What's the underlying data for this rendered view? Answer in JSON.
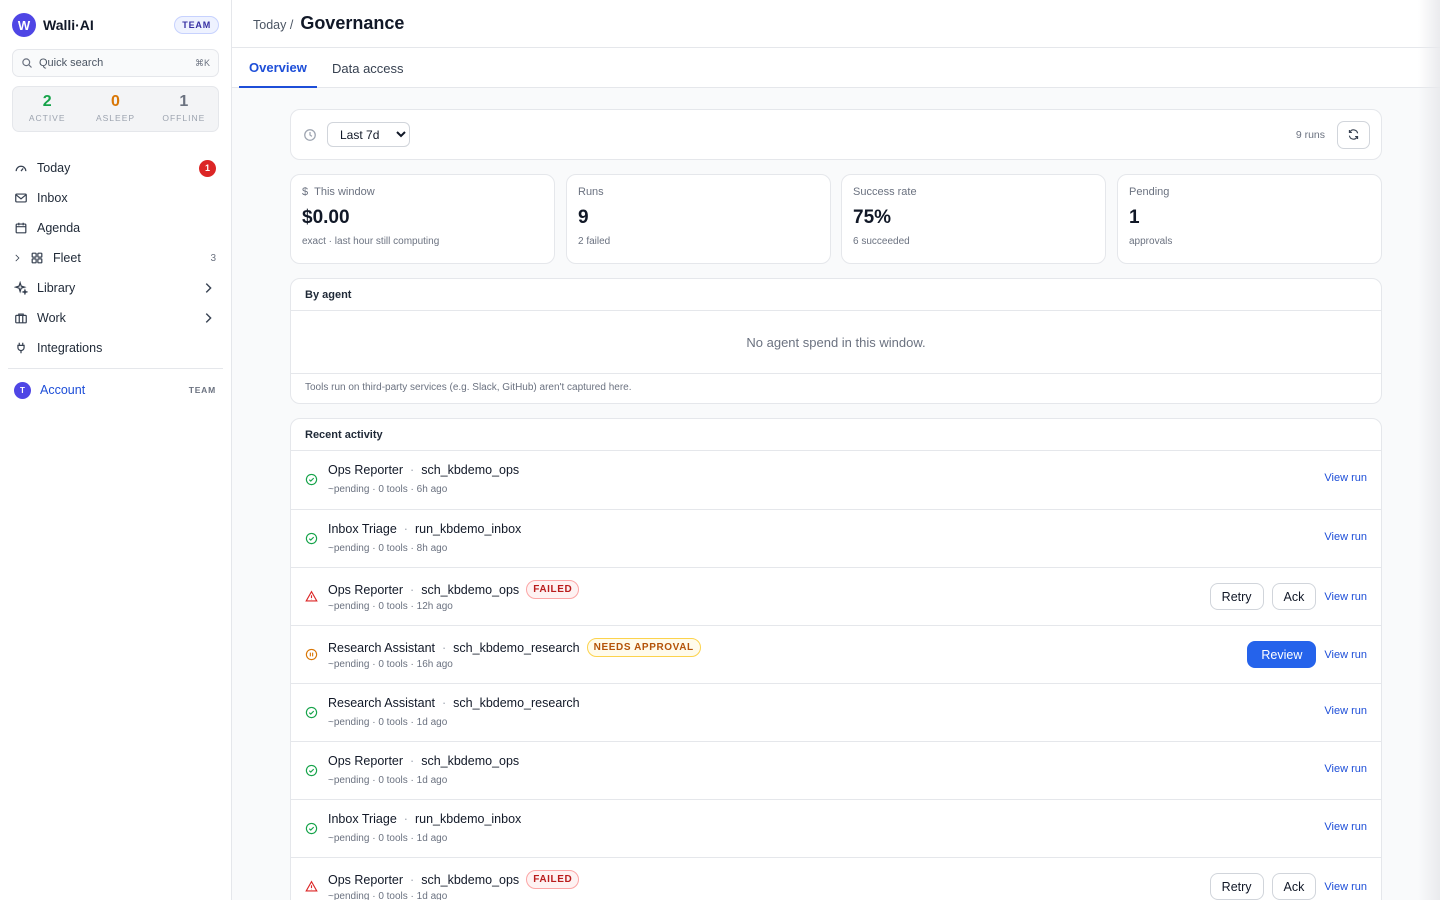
{
  "brand": {
    "logo_letter": "W",
    "name": "Walli·AI",
    "plan": "TEAM"
  },
  "search": {
    "placeholder": "Quick search",
    "shortcut": "⌘K"
  },
  "fleet_stats": [
    {
      "value": "2",
      "label": "ACTIVE",
      "color": "#16a34a"
    },
    {
      "value": "0",
      "label": "ASLEEP",
      "color": "#d97706"
    },
    {
      "value": "1",
      "label": "OFFLINE",
      "color": "#6b7280"
    }
  ],
  "nav": {
    "today": {
      "label": "Today",
      "badge": "1"
    },
    "inbox": {
      "label": "Inbox"
    },
    "agenda": {
      "label": "Agenda"
    },
    "fleet": {
      "label": "Fleet",
      "count": "3"
    },
    "library": {
      "label": "Library"
    },
    "work": {
      "label": "Work"
    },
    "integrations": {
      "label": "Integrations"
    }
  },
  "account": {
    "avatar": "T",
    "label": "Account",
    "plan": "TEAM"
  },
  "header": {
    "breadcrumb": "Today /",
    "title": "Governance"
  },
  "tabs": [
    {
      "label": "Overview",
      "active": true
    },
    {
      "label": "Data access",
      "active": false
    }
  ],
  "filter": {
    "range": "Last 7d",
    "options": [
      "Last 7d"
    ],
    "runs_count": "9 runs"
  },
  "kpis": [
    {
      "label": "This window",
      "value": "$0.00",
      "sub": "exact · last hour still computing"
    },
    {
      "label": "Runs",
      "value": "9",
      "sub": "2 failed"
    },
    {
      "label": "Success rate",
      "value": "75%",
      "sub": "6 succeeded"
    },
    {
      "label": "Pending",
      "value": "1",
      "sub": "approvals"
    }
  ],
  "by_agent": {
    "title": "By agent",
    "empty": "No agent spend in this window.",
    "footnote": "Tools run on third-party services (e.g. Slack, GitHub) aren't captured here."
  },
  "activity": {
    "title": "Recent activity",
    "view_run_label": "View run",
    "retry_label": "Retry",
    "ack_label": "Ack",
    "review_label": "Review",
    "rows": [
      {
        "status": "success",
        "agent": "Ops Reporter",
        "run_id": "sch_kbdemo_ops",
        "badge": "",
        "meta": "~pending · 0 tools · 6h ago"
      },
      {
        "status": "success",
        "agent": "Inbox Triage",
        "run_id": "run_kbdemo_inbox",
        "badge": "",
        "meta": "~pending · 0 tools · 8h ago"
      },
      {
        "status": "failed",
        "agent": "Ops Reporter",
        "run_id": "sch_kbdemo_ops",
        "badge": "FAILED",
        "meta": "~pending · 0 tools · 12h ago"
      },
      {
        "status": "approval",
        "agent": "Research Assistant",
        "run_id": "sch_kbdemo_research",
        "badge": "NEEDS APPROVAL",
        "meta": "~pending · 0 tools · 16h ago"
      },
      {
        "status": "success",
        "agent": "Research Assistant",
        "run_id": "sch_kbdemo_research",
        "badge": "",
        "meta": "~pending · 0 tools · 1d ago"
      },
      {
        "status": "success",
        "agent": "Ops Reporter",
        "run_id": "sch_kbdemo_ops",
        "badge": "",
        "meta": "~pending · 0 tools · 1d ago"
      },
      {
        "status": "success",
        "agent": "Inbox Triage",
        "run_id": "run_kbdemo_inbox",
        "badge": "",
        "meta": "~pending · 0 tools · 1d ago"
      },
      {
        "status": "failed",
        "agent": "Ops Reporter",
        "run_id": "sch_kbdemo_ops",
        "badge": "FAILED",
        "meta": "~pending · 0 tools · 1d ago"
      }
    ]
  }
}
